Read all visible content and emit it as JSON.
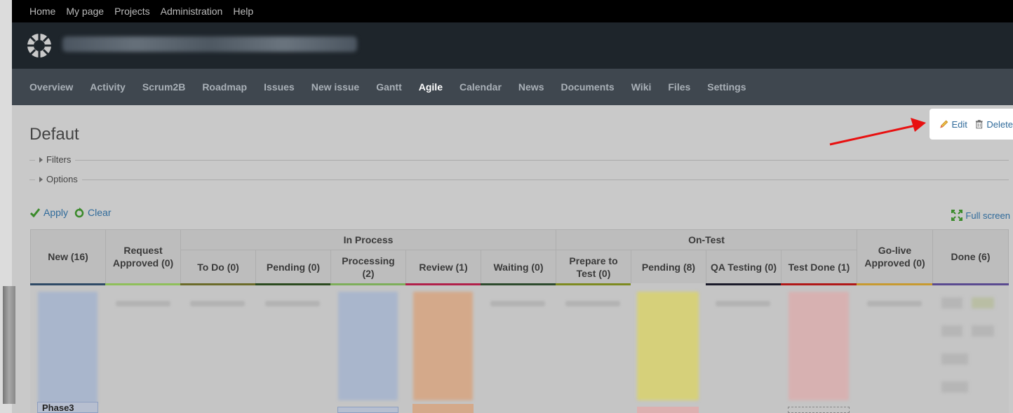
{
  "top_menu": [
    "Home",
    "My page",
    "Projects",
    "Administration",
    "Help"
  ],
  "main_menu": [
    "Overview",
    "Activity",
    "Scrum2B",
    "Roadmap",
    "Issues",
    "New issue",
    "Gantt",
    "Agile",
    "Calendar",
    "News",
    "Documents",
    "Wiki",
    "Files",
    "Settings"
  ],
  "active_tab": "Agile",
  "page": {
    "title": "Defaut",
    "filters_label": "Filters",
    "options_label": "Options",
    "apply_label": "Apply",
    "clear_label": "Clear",
    "fullscreen_label": "Full screen"
  },
  "actions": {
    "edit_label": "Edit",
    "delete_label": "Delete"
  },
  "board": {
    "groups": [
      "In Process",
      "On-Test"
    ],
    "columns": [
      {
        "label": "New (16)",
        "stripe": "#2f4a66"
      },
      {
        "label": "Request Approved (0)",
        "stripe": "#8fbf5a"
      },
      {
        "label": "To Do (0)",
        "stripe": "#6b6b2a"
      },
      {
        "label": "Pending (0)",
        "stripe": "#2b4a1f"
      },
      {
        "label": "Processing (2)",
        "stripe": "#7dae5a"
      },
      {
        "label": "Review (1)",
        "stripe": "#b0204a"
      },
      {
        "label": "Waiting (0)",
        "stripe": "#2d4a2d"
      },
      {
        "label": "Prepare to Test (0)",
        "stripe": "#7d8a20"
      },
      {
        "label": "Pending (8)",
        "stripe": "#c5c5c5"
      },
      {
        "label": "QA Testing (0)",
        "stripe": "#1a1a2a"
      },
      {
        "label": "Test Done (1)",
        "stripe": "#b01818"
      },
      {
        "label": "Go-live Approved (0)",
        "stripe": "#c79a30"
      },
      {
        "label": "Done (6)",
        "stripe": "#5a4a90"
      }
    ],
    "swimlane_label": "Phase3"
  },
  "colors": {
    "annotation_arrow": "#e81010",
    "link": "#2f6a9a",
    "check": "#3a8a2a"
  }
}
